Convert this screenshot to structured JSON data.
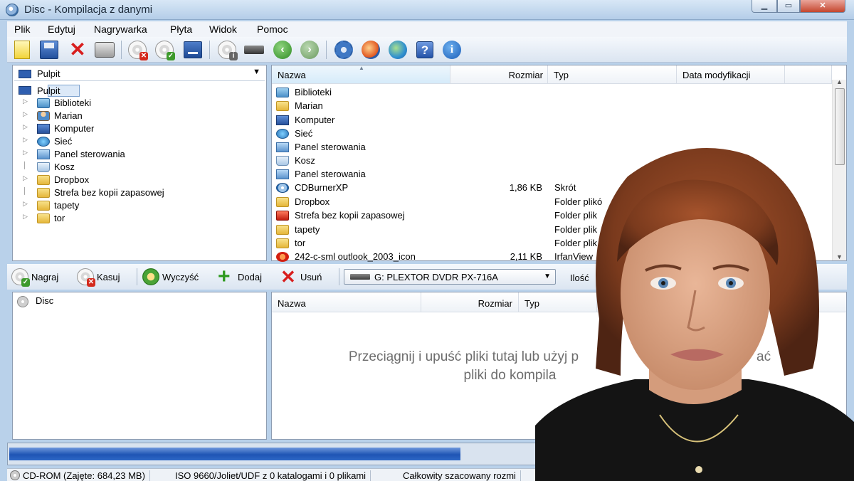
{
  "window": {
    "title": "Disc - Kompilacja z danymi"
  },
  "menu": [
    "Plik",
    "Edytuj",
    "Nagrywarka",
    "Płyta",
    "Widok",
    "Pomoc"
  ],
  "toolbar_icons": [
    "new-compilation-icon",
    "save-icon",
    "delete-icon",
    "print-icon",
    "erase-disc-icon",
    "burn-disc-icon",
    "eject-icon",
    "drive-info-icon",
    "drive-icon",
    "back-icon",
    "forward-icon",
    "settings-icon",
    "tools-icon",
    "web-icon",
    "help-icon",
    "about-icon"
  ],
  "tree": {
    "location": "Pulpit",
    "selected": "Pulpit",
    "items": [
      "Biblioteki",
      "Marian",
      "Komputer",
      "Sieć",
      "Panel sterowania",
      "Kosz",
      "Dropbox",
      "Strefa bez kopii zapasowej",
      "tapety",
      "tor"
    ]
  },
  "file_list": {
    "columns": [
      "Nazwa",
      "Rozmiar",
      "Typ",
      "Data modyfikacji"
    ],
    "rows": [
      {
        "name": "Biblioteki",
        "size": "",
        "type": ""
      },
      {
        "name": "Marian",
        "size": "",
        "type": ""
      },
      {
        "name": "Komputer",
        "size": "",
        "type": ""
      },
      {
        "name": "Sieć",
        "size": "",
        "type": ""
      },
      {
        "name": "Panel sterowania",
        "size": "",
        "type": ""
      },
      {
        "name": "Kosz",
        "size": "",
        "type": ""
      },
      {
        "name": "Panel sterowania",
        "size": "",
        "type": ""
      },
      {
        "name": "CDBurnerXP",
        "size": "1,86 KB",
        "type": "Skrót"
      },
      {
        "name": "Dropbox",
        "size": "",
        "type": "Folder plikó"
      },
      {
        "name": "Strefa bez kopii zapasowej",
        "size": "",
        "type": "Folder plik"
      },
      {
        "name": "tapety",
        "size": "",
        "type": "Folder plik"
      },
      {
        "name": "tor",
        "size": "",
        "type": "Folder plik"
      },
      {
        "name": "242-c-sml outlook_2003_icon",
        "size": "2,11 KB",
        "type": "IrfanView"
      }
    ]
  },
  "actions": {
    "burn": "Nagraj",
    "erase": "Kasuj",
    "clear": "Wyczyść",
    "add": "Dodaj",
    "remove": "Usuń",
    "drive": "G: PLEXTOR DVDR  PX-716A",
    "copies_label": "Ilość"
  },
  "disc_tree": {
    "root": "Disc"
  },
  "compilation": {
    "columns": [
      "Nazwa",
      "Rozmiar",
      "Typ"
    ],
    "hint_line1": "Przeciągnij i upuść pliki tutaj lub użyj p",
    "hint_line1_end": "ać",
    "hint_line2": "pliki do kompila"
  },
  "progress": {
    "fill_fraction": 0.54
  },
  "status": {
    "disc": "CD-ROM (Zajęte: 684,23 MB)",
    "filesystem": "ISO 9660/Joliet/UDF z 0 katalogami i 0 plikami",
    "total": "Całkowity szacowany rozmi"
  }
}
